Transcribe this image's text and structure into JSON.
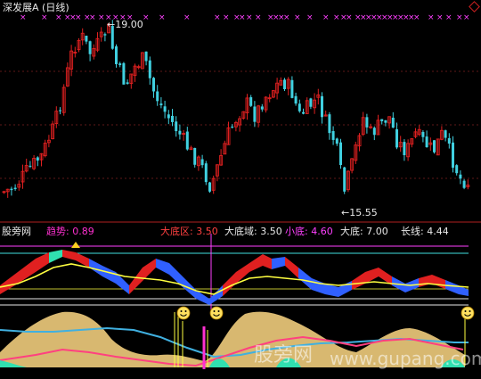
{
  "title": {
    "stock": "深发展A",
    "period": "(日线)"
  },
  "price": {
    "high_label": "←19.00",
    "low_label": "←15.55"
  },
  "indicator": {
    "website": "股旁网",
    "trend_label": "趋势:",
    "trend_value": "0.89",
    "bottom_zone_label": "大底区:",
    "bottom_zone_value": "3.50",
    "bottom_domain_label": "大底域:",
    "bottom_domain_value": "3.50",
    "small_bottom_label": "小底:",
    "small_bottom_value": "4.60",
    "big_bottom_label": "大底:",
    "big_bottom_value": "7.00",
    "long_line_label": "长线:",
    "long_line_value": "4.44"
  },
  "watermark": {
    "cn": "股旁网",
    "url": "www.gupang.com"
  },
  "colors": {
    "up": "#e02020",
    "down": "#40d0e0",
    "magenta": "#ff40ff",
    "yellow": "#ffff40",
    "tan": "#d8b870",
    "trend": "#ff30d0",
    "bottom_zone": "#ff4040",
    "white": "#e8e8e8",
    "blue": "#3060ff"
  },
  "icons": [
    "smiley-icon",
    "warning-triangle-icon",
    "cross-marker-icon"
  ]
}
